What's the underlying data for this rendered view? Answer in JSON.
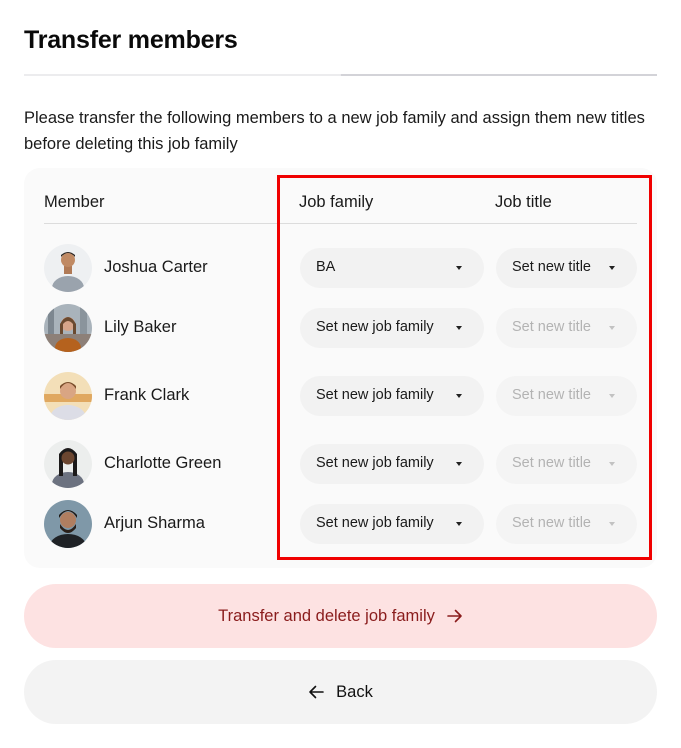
{
  "header": {
    "title": "Transfer members",
    "progress": {
      "current_step": 1,
      "total_steps": 2
    }
  },
  "description": "Please transfer the following members to a new job family and assign them new titles before deleting this job family",
  "table": {
    "columns": {
      "member": "Member",
      "job_family": "Job family",
      "job_title": "Job title"
    },
    "rows": [
      {
        "name": "Joshua Carter",
        "avatar": "photo-man-grey-tshirt",
        "job_family": "BA",
        "job_title": "Set new title",
        "title_enabled": true
      },
      {
        "name": "Lily Baker",
        "avatar": "photo-woman-city",
        "job_family": "Set new job family",
        "job_title": "Set new title",
        "title_enabled": false
      },
      {
        "name": "Frank Clark",
        "avatar": "photo-man-white-shirt",
        "job_family": "Set new job family",
        "job_title": "Set new title",
        "title_enabled": false
      },
      {
        "name": "Charlotte Green",
        "avatar": "photo-woman-braids",
        "job_family": "Set new job family",
        "job_title": "Set new title",
        "title_enabled": false
      },
      {
        "name": "Arjun Sharma",
        "avatar": "photo-man-beard",
        "job_family": "Set new job family",
        "job_title": "Set new title",
        "title_enabled": false
      }
    ]
  },
  "actions": {
    "primary_label": "Transfer and delete job family",
    "primary_icon": "arrow-right-icon",
    "back_label": "Back",
    "back_icon": "arrow-left-icon"
  },
  "colors": {
    "primary_bg": "#fde2e2",
    "primary_text": "#8a1c1c",
    "highlight": "#f00000"
  }
}
